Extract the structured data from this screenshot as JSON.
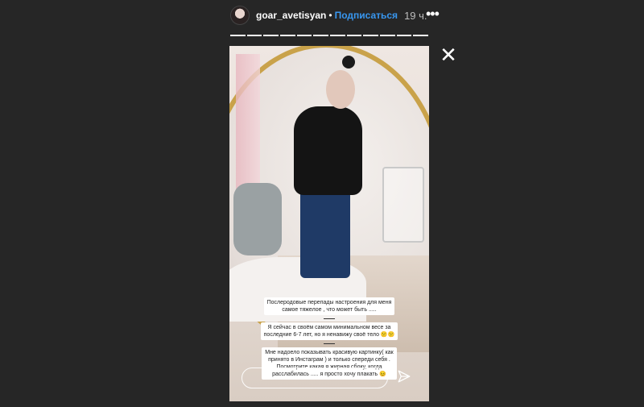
{
  "header": {
    "username": "goar_avetisyan",
    "separator": "•",
    "subscribe_label": "Подписаться",
    "time": "19 ч.",
    "more_label": "•••"
  },
  "progress": {
    "segments": 12
  },
  "close_label": "✕",
  "captions": [
    {
      "lines": [
        "Послеродовые перепады настроения для меня",
        "самое тяжелое , что может быть ....."
      ]
    },
    {
      "lines": [
        "Я сейчас в своём самом минимальном весе за",
        "последние 6-7 лет, но я ненавижу своё тело 😕😕"
      ]
    },
    {
      "lines": [
        "Мне надоело показывать красивую картинку( как",
        "принято в Инстаграм )  и только спереди себя .",
        "Посмотрите какая я жирная сбоку, когда",
        "расслабилась ..... я просто хочу плакать 😣"
      ]
    }
  ],
  "icons": {
    "close": "close-icon",
    "more": "more-icon",
    "send": "send-icon"
  }
}
